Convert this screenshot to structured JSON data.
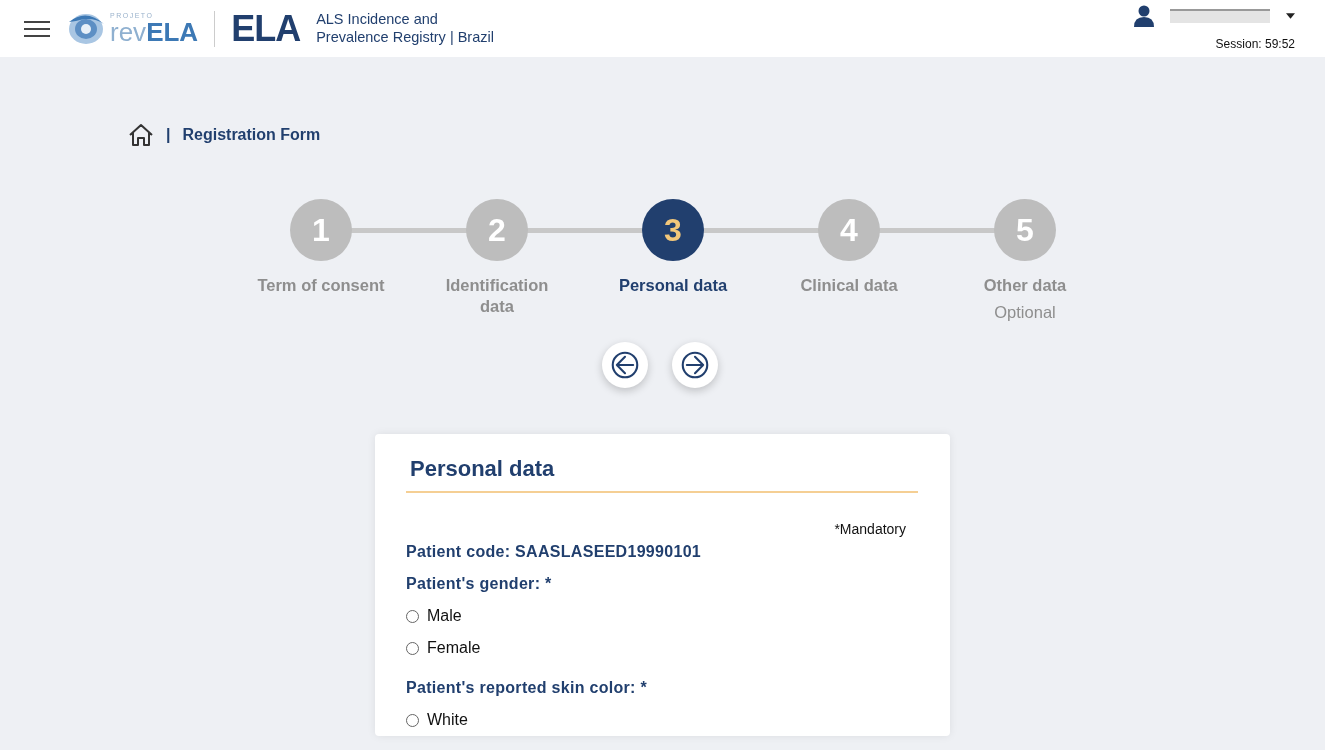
{
  "header": {
    "logo": {
      "small": "PROJETO",
      "prefix": "rev",
      "suffix": "ELA"
    },
    "brand": "ELA",
    "subtitle_lines": [
      "ALS Incidence and",
      "Prevalence Registry | Brazil"
    ],
    "user": {
      "name_redacted": true
    },
    "session": "Session:  59:52"
  },
  "breadcrumb": {
    "separator": "|",
    "current": "Registration Form"
  },
  "steps": [
    {
      "number": "1",
      "label": "Term of consent",
      "selected": false
    },
    {
      "number": "2",
      "label": "Identification data",
      "selected": false
    },
    {
      "number": "3",
      "label": "Personal data",
      "selected": true
    },
    {
      "number": "4",
      "label": "Clinical data",
      "selected": false
    },
    {
      "number": "5",
      "label": "Other data",
      "note": "Optional",
      "selected": false
    }
  ],
  "form": {
    "title": "Personal data",
    "mandatory_note": "*Mandatory",
    "patient_code": "Patient code: SAASLASEED19990101",
    "questions": [
      {
        "label": "Patient's gender: *",
        "options": [
          {
            "label": "Male",
            "checked": false
          },
          {
            "label": "Female",
            "checked": false
          }
        ]
      },
      {
        "label": "Patient's reported skin color: *",
        "options": [
          {
            "label": "White",
            "checked": false
          }
        ]
      }
    ]
  }
}
